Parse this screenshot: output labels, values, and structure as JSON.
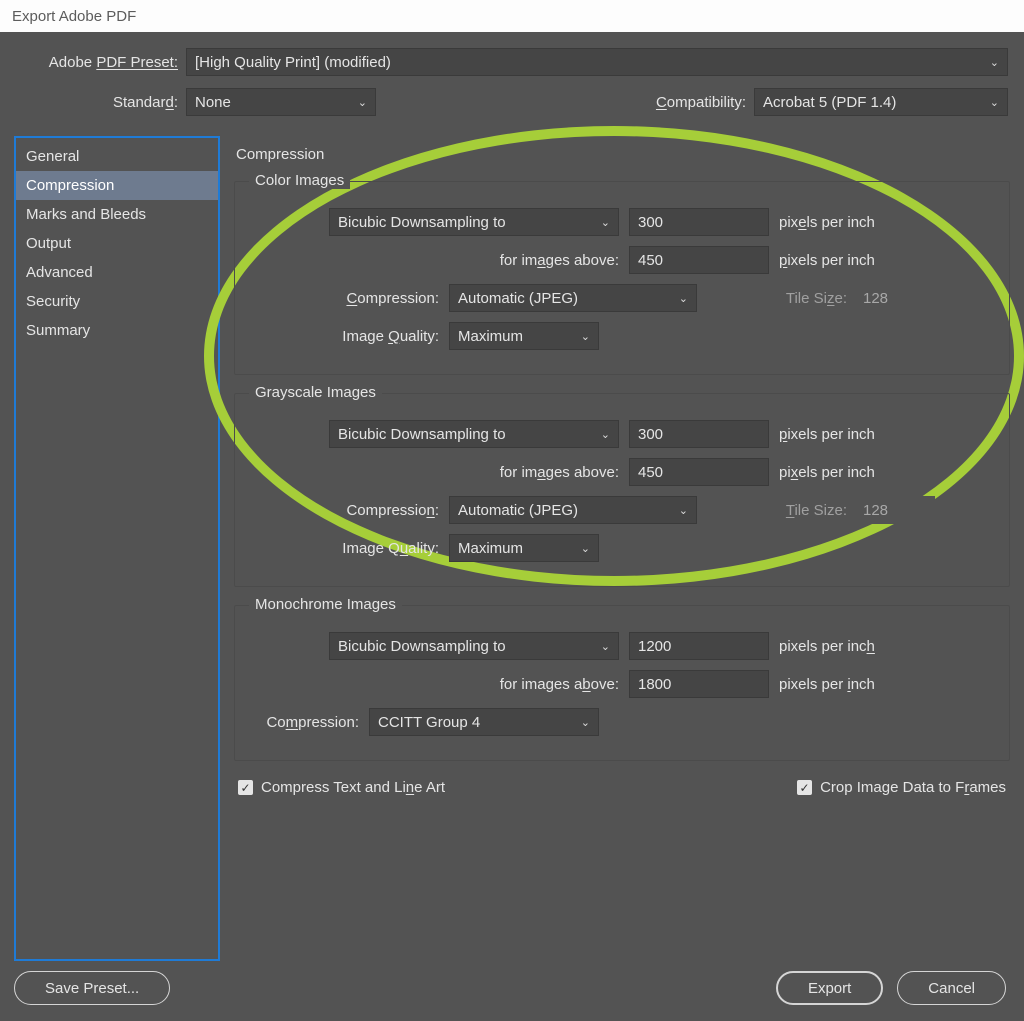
{
  "title": "Export Adobe PDF",
  "header": {
    "preset_label_pre": "Adobe ",
    "preset_label_u": "PDF Preset:",
    "preset_value": "[High Quality Print] (modified)",
    "standard_label_pre": "Standar",
    "standard_label_u": "d",
    "standard_label_post": ":",
    "standard_value": "None",
    "compat_label_pre": "",
    "compat_label_u": "C",
    "compat_label_post": "ompatibility:",
    "compat_value": "Acrobat 5 (PDF 1.4)"
  },
  "sidebar": {
    "items": [
      "General",
      "Compression",
      "Marks and Bleeds",
      "Output",
      "Advanced",
      "Security",
      "Summary"
    ],
    "selected": 1
  },
  "panel_title": "Compression",
  "color": {
    "title": "Color Images",
    "sampling": "Bicubic Downsampling to",
    "ppi1": "300",
    "ppi_unit_pre": "pix",
    "ppi_unit_u": "e",
    "ppi_unit_post": "ls per inch",
    "above_pre": "for im",
    "above_u": "a",
    "above_post": "ges above:",
    "ppi2": "450",
    "ppi2_unit_pre": "",
    "ppi2_unit_u": "p",
    "ppi2_unit_post": "ixels per inch",
    "compr_lbl_u": "C",
    "compr_lbl_post": "ompression:",
    "compr_val": "Automatic (JPEG)",
    "tile_pre": "Tile Si",
    "tile_u": "z",
    "tile_post": "e:",
    "tile_val": "128",
    "quality_lbl_pre": "Image ",
    "quality_lbl_u": "Q",
    "quality_lbl_post": "uality:",
    "quality_val": "Maximum"
  },
  "gray": {
    "title": "Grayscale Images",
    "sampling": "Bicubic Downsampling to",
    "ppi1": "300",
    "ppi_unit_pre": "",
    "ppi_unit_u": "p",
    "ppi_unit_post": "ixels per inch",
    "above_pre": "for im",
    "above_u": "a",
    "above_post": "ges above:",
    "ppi2": "450",
    "ppi2_unit_pre": "pi",
    "ppi2_unit_u": "x",
    "ppi2_unit_post": "els per inch",
    "compr_lbl_pre": "Compressio",
    "compr_lbl_u": "n",
    "compr_lbl_post": ":",
    "compr_val": "Automatic (JPEG)",
    "tile_pre": "",
    "tile_u": "T",
    "tile_post": "ile Size:",
    "tile_val": "128",
    "quality_lbl_pre": "Image Q",
    "quality_lbl_u": "u",
    "quality_lbl_post": "ality:",
    "quality_val": "Maximum"
  },
  "mono": {
    "title": "Monochrome Images",
    "sampling": "Bicubic Downsampling to",
    "ppi1": "1200",
    "ppi_unit_pre": "pixels per inc",
    "ppi_unit_u": "h",
    "ppi_unit_post": "",
    "above_pre": "for images a",
    "above_u": "b",
    "above_post": "ove:",
    "ppi2": "1800",
    "ppi2_unit_pre": "pixels per ",
    "ppi2_unit_u": "i",
    "ppi2_unit_post": "nch",
    "compr_lbl_pre": "Co",
    "compr_lbl_u": "m",
    "compr_lbl_post": "pression:",
    "compr_val": "CCITT Group 4"
  },
  "checks": {
    "compress_pre": "Compress Text and Li",
    "compress_u": "n",
    "compress_post": "e Art",
    "crop_pre": "Crop Image Data to F",
    "crop_u": "r",
    "crop_post": "ames"
  },
  "footer": {
    "save_preset": "Save Preset...",
    "export": "Export",
    "cancel": "Cancel"
  }
}
